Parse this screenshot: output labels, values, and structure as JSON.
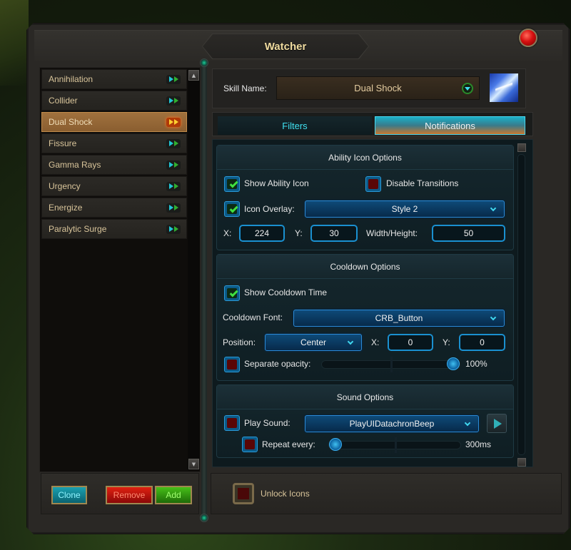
{
  "window": {
    "title": "Watcher"
  },
  "skills": {
    "items": [
      {
        "label": "Annihilation",
        "selected": false
      },
      {
        "label": "Collider",
        "selected": false
      },
      {
        "label": "Dual Shock",
        "selected": true
      },
      {
        "label": "Fissure",
        "selected": false
      },
      {
        "label": "Gamma Rays",
        "selected": false
      },
      {
        "label": "Urgency",
        "selected": false
      },
      {
        "label": "Energize",
        "selected": false
      },
      {
        "label": "Paralytic Surge",
        "selected": false
      }
    ],
    "buttons": {
      "clone": "Clone",
      "remove": "Remove",
      "add": "Add"
    }
  },
  "skill_name": {
    "label": "Skill Name:",
    "value": "Dual Shock"
  },
  "tabs": [
    {
      "label": "Filters",
      "active": false
    },
    {
      "label": "Notifications",
      "active": true
    }
  ],
  "ability_icon_options": {
    "title": "Ability Icon Options",
    "show_ability_icon": {
      "label": "Show Ability Icon",
      "checked": true
    },
    "disable_transitions": {
      "label": "Disable Transitions",
      "checked": false
    },
    "icon_overlay": {
      "label": "Icon Overlay:",
      "checked": true,
      "value": "Style 2"
    },
    "x": {
      "label": "X:",
      "value": "224"
    },
    "y": {
      "label": "Y:",
      "value": "30"
    },
    "width_height": {
      "label": "Width/Height:",
      "value": "50"
    }
  },
  "cooldown_options": {
    "title": "Cooldown Options",
    "show_cooldown_time": {
      "label": "Show Cooldown Time",
      "checked": true
    },
    "cooldown_font": {
      "label": "Cooldown Font:",
      "value": "CRB_Button"
    },
    "position": {
      "label": "Position:",
      "value": "Center"
    },
    "x": {
      "label": "X:",
      "value": "0"
    },
    "y": {
      "label": "Y:",
      "value": "0"
    },
    "separate_opacity": {
      "label": "Separate opacity:",
      "checked": false,
      "value_text": "100%",
      "value": 1.0
    }
  },
  "sound_options": {
    "title": "Sound Options",
    "play_sound": {
      "label": "Play Sound:",
      "checked": false,
      "value": "PlayUIDatachronBeep"
    },
    "repeat_every": {
      "label": "Repeat every:",
      "checked": false,
      "value_text": "300ms",
      "value": 0.0
    }
  },
  "unlock_icons": {
    "label": "Unlock Icons",
    "checked": false
  },
  "colors": {
    "accent_cyan": "#40e0f0",
    "selected_item": "#a0713e",
    "checkbox_on": "#40e040",
    "checkbox_off": "#5a0606",
    "title_gold": "#f0dca0"
  }
}
